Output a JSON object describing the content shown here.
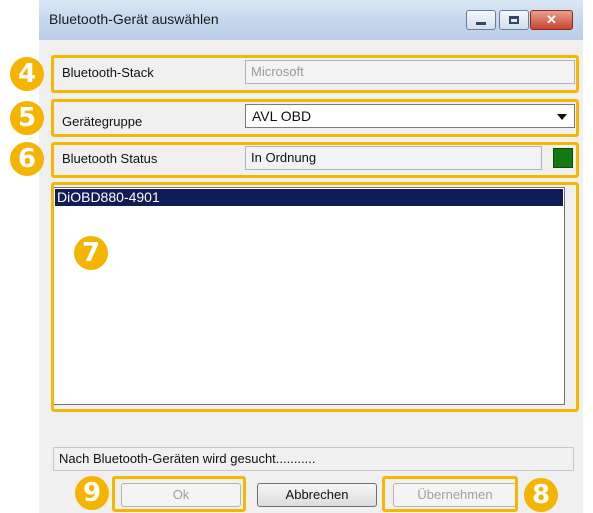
{
  "window": {
    "title": "Bluetooth-Gerät auswählen",
    "controls": {
      "minimize": "minimize-icon",
      "maximize": "maximize-icon",
      "close": "close-icon"
    }
  },
  "rows": {
    "stack": {
      "label": "Bluetooth-Stack",
      "value": "Microsoft"
    },
    "group": {
      "label": "Gerätegruppe",
      "value": "AVL OBD"
    },
    "status": {
      "label": "Bluetooth Status",
      "value": "In Ordnung",
      "indicator_color": "#137a13"
    }
  },
  "device_list": {
    "items": [
      {
        "label": "DiOBD880-4901",
        "selected": true
      }
    ]
  },
  "status_message": "Nach Bluetooth-Geräten wird gesucht...........",
  "buttons": {
    "ok": "Ok",
    "cancel": "Abbrechen",
    "apply": "Übernehmen"
  },
  "annotations": {
    "marker_4": "4",
    "marker_5": "5",
    "marker_6": "6",
    "marker_7": "7",
    "marker_8": "8",
    "marker_9": "9",
    "accent_color": "#f4b400"
  }
}
